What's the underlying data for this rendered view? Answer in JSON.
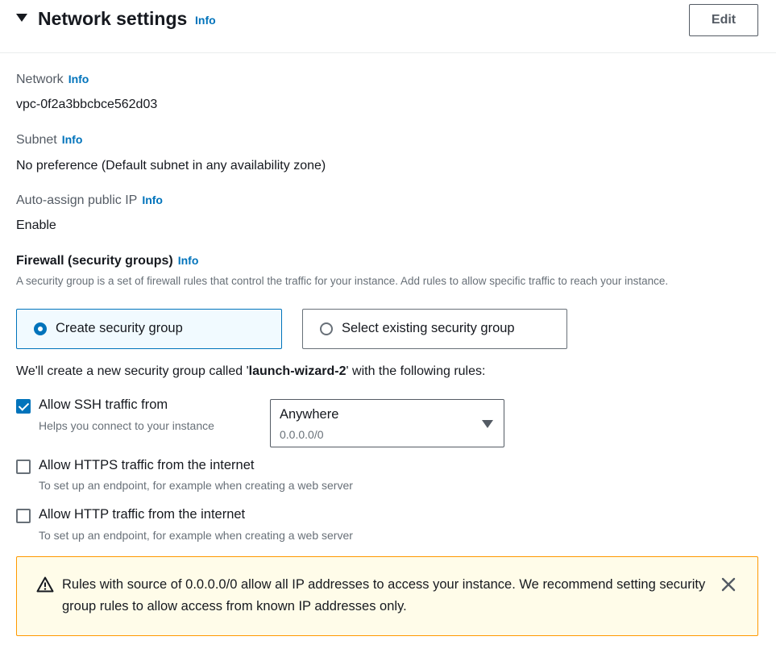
{
  "section": {
    "title": "Network settings",
    "info": "Info",
    "edit_label": "Edit"
  },
  "network": {
    "label": "Network",
    "info": "Info",
    "value": "vpc-0f2a3bbcbce562d03"
  },
  "subnet": {
    "label": "Subnet",
    "info": "Info",
    "value": "No preference (Default subnet in any availability zone)"
  },
  "public_ip": {
    "label": "Auto-assign public IP",
    "info": "Info",
    "value": "Enable"
  },
  "firewall": {
    "title": "Firewall (security groups)",
    "info": "Info",
    "description": "A security group is a set of firewall rules that control the traffic for your instance. Add rules to allow specific traffic to reach your instance.",
    "options": [
      {
        "label": "Create security group",
        "selected": true
      },
      {
        "label": "Select existing security group",
        "selected": false
      }
    ],
    "create_msg_prefix": "We'll create a new security group called '",
    "group_name": "launch-wizard-2",
    "create_msg_suffix": "' with the following rules:"
  },
  "rules": [
    {
      "label": "Allow SSH traffic from",
      "description": "Helps you connect to your instance",
      "checked": true
    },
    {
      "label": "Allow HTTPS traffic from the internet",
      "description": "To set up an endpoint, for example when creating a web server",
      "checked": false
    },
    {
      "label": "Allow HTTP traffic from the internet",
      "description": "To set up an endpoint, for example when creating a web server",
      "checked": false
    }
  ],
  "ssh_source": {
    "value": "Anywhere",
    "sub": "0.0.0.0/0"
  },
  "warning": {
    "text": "Rules with source of 0.0.0.0/0 allow all IP addresses to access your instance. We recommend setting security group rules to allow access from known IP addresses only."
  },
  "colors": {
    "accent": "#0073bb",
    "warning_border": "#ff9900",
    "warning_bg": "#fffce9"
  }
}
